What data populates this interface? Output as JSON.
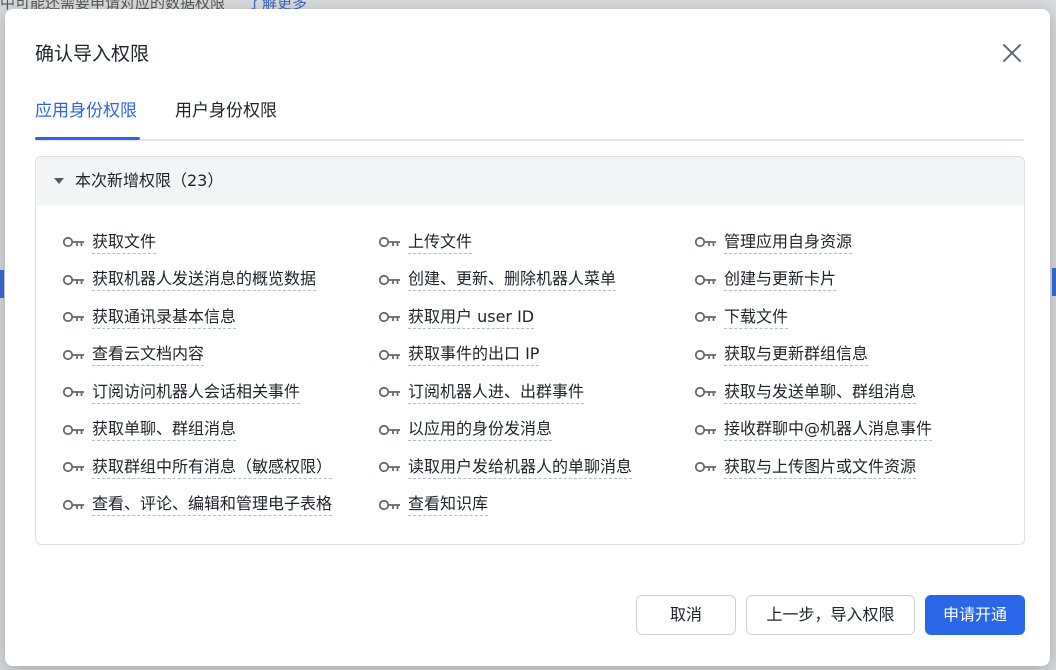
{
  "background": {
    "hint_text": "中可能还需要申请对应的数据权限",
    "hint_link": "了解更多"
  },
  "dialog": {
    "title": "确认导入权限",
    "tabs": [
      {
        "label": "应用身份权限",
        "active": true
      },
      {
        "label": "用户身份权限",
        "active": false
      }
    ],
    "section": {
      "title": "本次新增权限（23）",
      "expanded": true
    },
    "permissions": [
      "获取文件",
      "上传文件",
      "管理应用自身资源",
      "获取机器人发送消息的概览数据",
      "创建、更新、删除机器人菜单",
      "创建与更新卡片",
      "获取通讯录基本信息",
      "获取用户 user ID",
      "下载文件",
      "查看云文档内容",
      "获取事件的出口 IP",
      "获取与更新群组信息",
      "订阅访问机器人会话相关事件",
      "订阅机器人进、出群事件",
      "获取与发送单聊、群组消息",
      "获取单聊、群组消息",
      "以应用的身份发消息",
      "接收群聊中@机器人消息事件",
      "获取群组中所有消息（敏感权限）",
      "读取用户发给机器人的单聊消息",
      "获取与上传图片或文件资源",
      "查看、评论、编辑和管理电子表格",
      "查看知识库"
    ],
    "buttons": {
      "cancel": "取消",
      "prev": "上一步，导入权限",
      "apply": "申请开通"
    }
  },
  "colors": {
    "accent": "#2a67e8",
    "text": "#1f2329",
    "panel_header": "#f3f4f6"
  }
}
